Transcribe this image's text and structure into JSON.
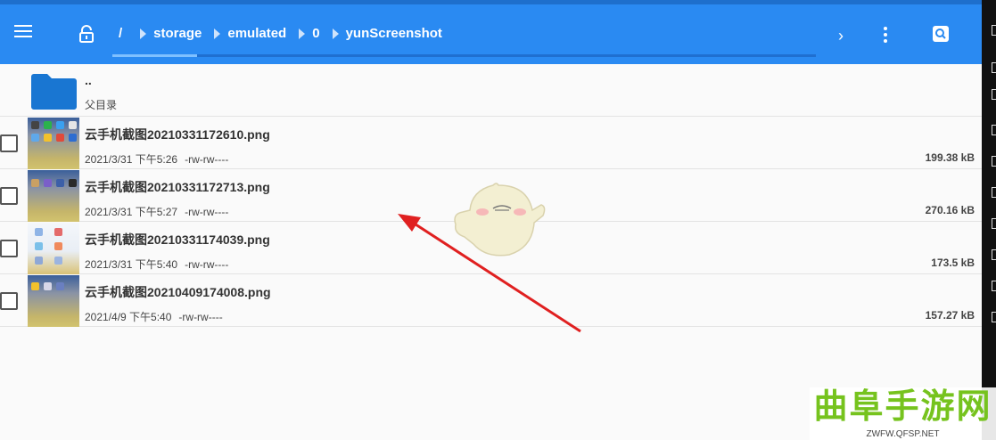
{
  "header": {
    "root_label": "/",
    "breadcrumbs": [
      "storage",
      "emulated",
      "0",
      "yunScreenshot"
    ],
    "forward_icon": "chevron-right-icon",
    "more_icon": "more-vertical-icon",
    "search_icon": "search-icon",
    "menu_icon": "menu-icon",
    "lock_icon": "lock-open-icon",
    "forward_glyph": "›"
  },
  "colors": {
    "toolbar": "#2a8af2",
    "folder": "#1976d2",
    "watermark": "#76c31e"
  },
  "parent_dir": {
    "name": "..",
    "subtitle": "父目录"
  },
  "files": [
    {
      "name": "云手机截图20210331172610.png",
      "date": "2021/3/31 下午5:26",
      "perms": "-rw-rw----",
      "size": "199.38 kB"
    },
    {
      "name": "云手机截图20210331172713.png",
      "date": "2021/3/31 下午5:27",
      "perms": "-rw-rw----",
      "size": "270.16 kB"
    },
    {
      "name": "云手机截图20210331174039.png",
      "date": "2021/3/31 下午5:40",
      "perms": "-rw-rw----",
      "size": "173.5 kB"
    },
    {
      "name": "云手机截图20210409174008.png",
      "date": "2021/4/9 下午5:40",
      "perms": "-rw-rw----",
      "size": "157.27 kB"
    }
  ],
  "watermark": {
    "title": "曲阜手游网",
    "url": "ZWFW.QFSP.NET"
  }
}
